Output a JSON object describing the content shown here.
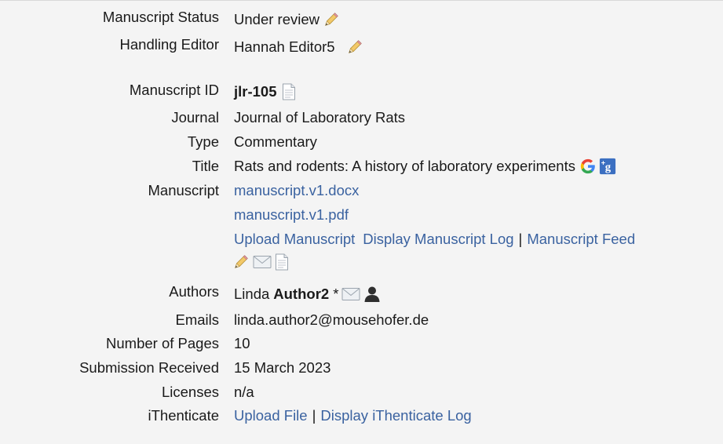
{
  "manuscript_status": {
    "label": "Manuscript Status",
    "value": "Under review"
  },
  "handling_editor": {
    "label": "Handling Editor",
    "value": "Hannah Editor5"
  },
  "manuscript_id": {
    "label": "Manuscript ID",
    "value": "jlr-105"
  },
  "journal": {
    "label": "Journal",
    "value": "Journal of Laboratory Rats"
  },
  "type": {
    "label": "Type",
    "value": "Commentary"
  },
  "title": {
    "label": "Title",
    "value": "Rats and rodents: A history of laboratory experiments"
  },
  "manuscript": {
    "label": "Manuscript",
    "files": [
      "manuscript.v1.docx",
      "manuscript.v1.pdf"
    ],
    "actions": {
      "upload": "Upload Manuscript",
      "log": "Display Manuscript Log",
      "separator": "|",
      "feed": "Manuscript Feed"
    }
  },
  "authors": {
    "label": "Authors",
    "first_name": "Linda",
    "last_name": "Author2",
    "marker": "*"
  },
  "emails": {
    "label": "Emails",
    "value": "linda.author2@mousehofer.de"
  },
  "pages": {
    "label": "Number of Pages",
    "value": "10"
  },
  "submission": {
    "label": "Submission Received",
    "value": "15 March 2023"
  },
  "licenses": {
    "label": "Licenses",
    "value": "n/a"
  },
  "ithenticate": {
    "label": "iThenticate",
    "upload": "Upload File",
    "separator": "|",
    "log": "Display iThenticate Log"
  },
  "icons": [
    "pencil-icon",
    "document-icon",
    "google-icon",
    "google-plus-icon",
    "envelope-icon",
    "person-icon"
  ],
  "colors": {
    "link": "#3a62a0",
    "background": "#f4f4f4",
    "text": "#1a1a1a"
  }
}
